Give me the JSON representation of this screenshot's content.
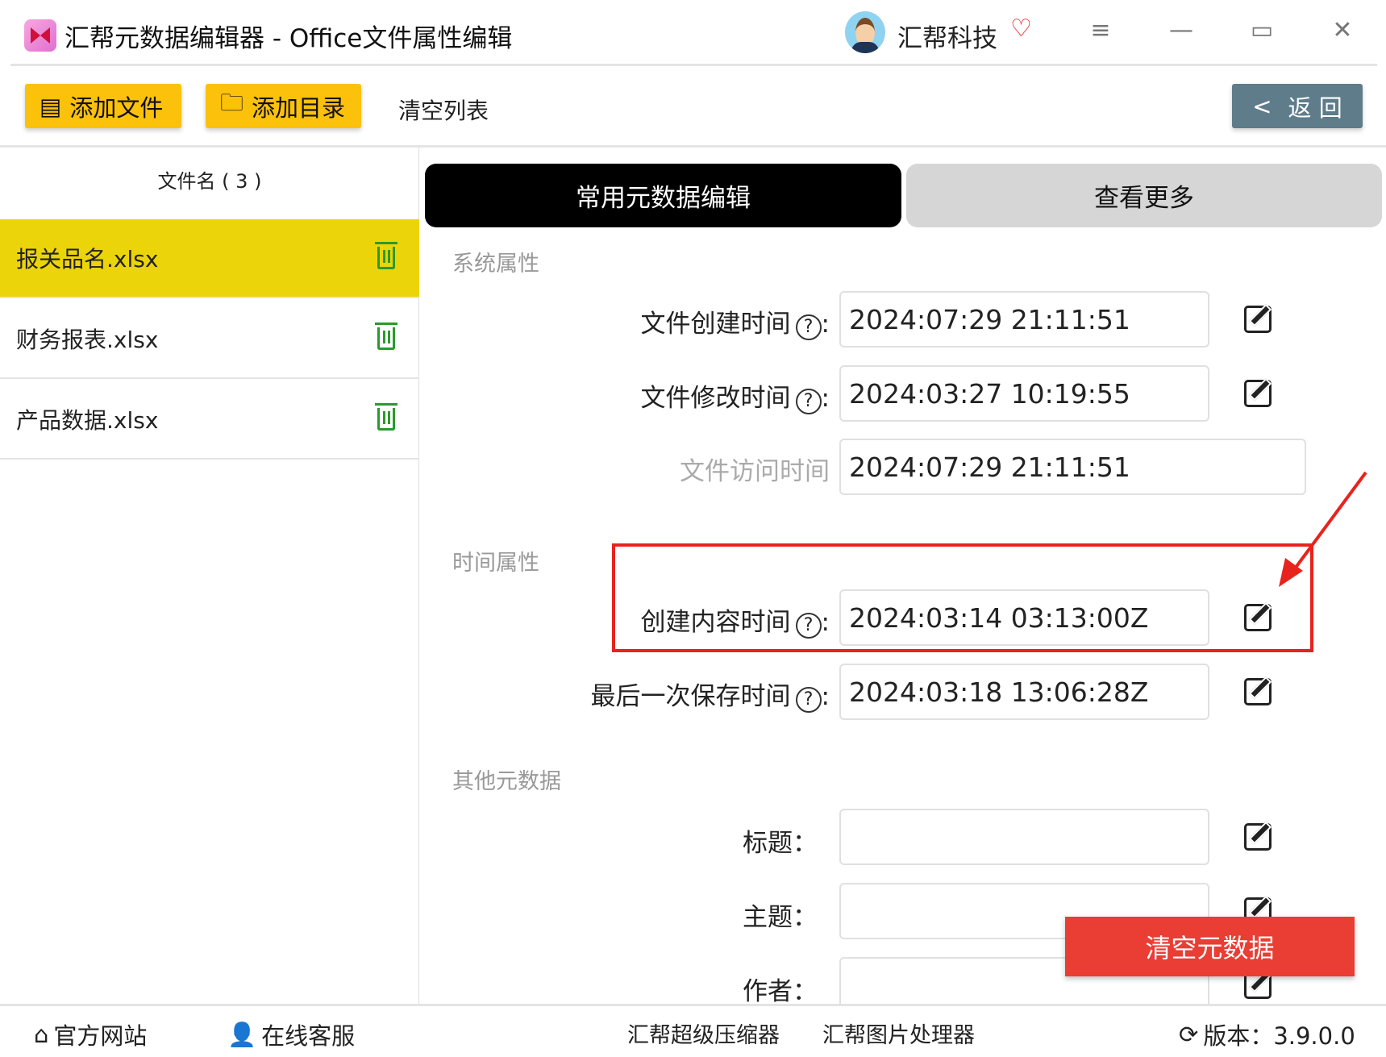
{
  "app": {
    "title": "汇帮元数据编辑器 - Office文件属性编辑",
    "brand": "汇帮科技"
  },
  "toolbar": {
    "add_file": "添加文件",
    "add_dir": "添加目录",
    "clear_list": "清空列表",
    "back": "返 回"
  },
  "file_list": {
    "header": "文件名 ( 3 )",
    "files": [
      "报关品名.xlsx",
      "财务报表.xlsx",
      "产品数据.xlsx"
    ]
  },
  "tabs": [
    "常用元数据编辑",
    "查看更多"
  ],
  "sections": {
    "system": "系统属性",
    "time": "时间属性",
    "other": "其他元数据"
  },
  "fields": {
    "created": {
      "label": "文件创建时间",
      "value": "2024:07:29 21:11:51"
    },
    "modified": {
      "label": "文件修改时间",
      "value": "2024:03:27 10:19:55"
    },
    "accessed": {
      "label": "文件访问时间",
      "value": "2024:07:29 21:11:51"
    },
    "content_created": {
      "label": "创建内容时间",
      "value": "2024:03:14 03:13:00Z"
    },
    "last_saved": {
      "label": "最后一次保存时间",
      "value": "2024:03:18 13:06:28Z"
    },
    "title": {
      "label": "标题：",
      "value": ""
    },
    "subject": {
      "label": "主题：",
      "value": ""
    },
    "author": {
      "label": "作者：",
      "value": ""
    }
  },
  "clear_metadata": "清空元数据",
  "footer": {
    "website": "官方网站",
    "support": "在线客服",
    "compressor": "汇帮超级压缩器",
    "image_tool": "汇帮图片处理器",
    "version": "版本：3.9.0.0"
  },
  "colors": {
    "accent": "#fbc10b",
    "selected": "#ecd40a",
    "danger": "#ea3d33",
    "back": "#5f7c8a"
  }
}
